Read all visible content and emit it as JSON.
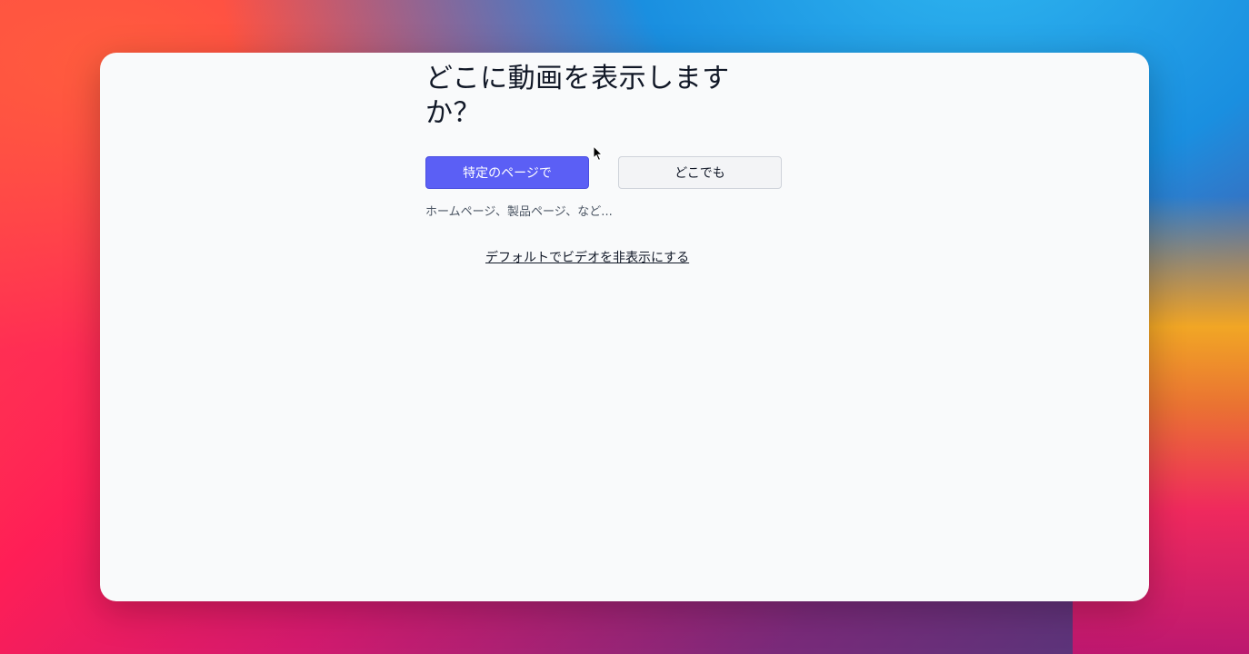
{
  "dialog": {
    "title": "どこに動画を表示しますか？",
    "options": {
      "specific_pages_label": "特定のページで",
      "everywhere_label": "どこでも"
    },
    "hint": "ホームページ、製品ページ、など...",
    "hide_by_default_link": "デフォルトでビデオを非表示にする"
  },
  "colors": {
    "primary_button": "#5b5ff5",
    "window_background": "#f9fafb"
  },
  "icons": {
    "cursor": "mouse-pointer-icon"
  }
}
